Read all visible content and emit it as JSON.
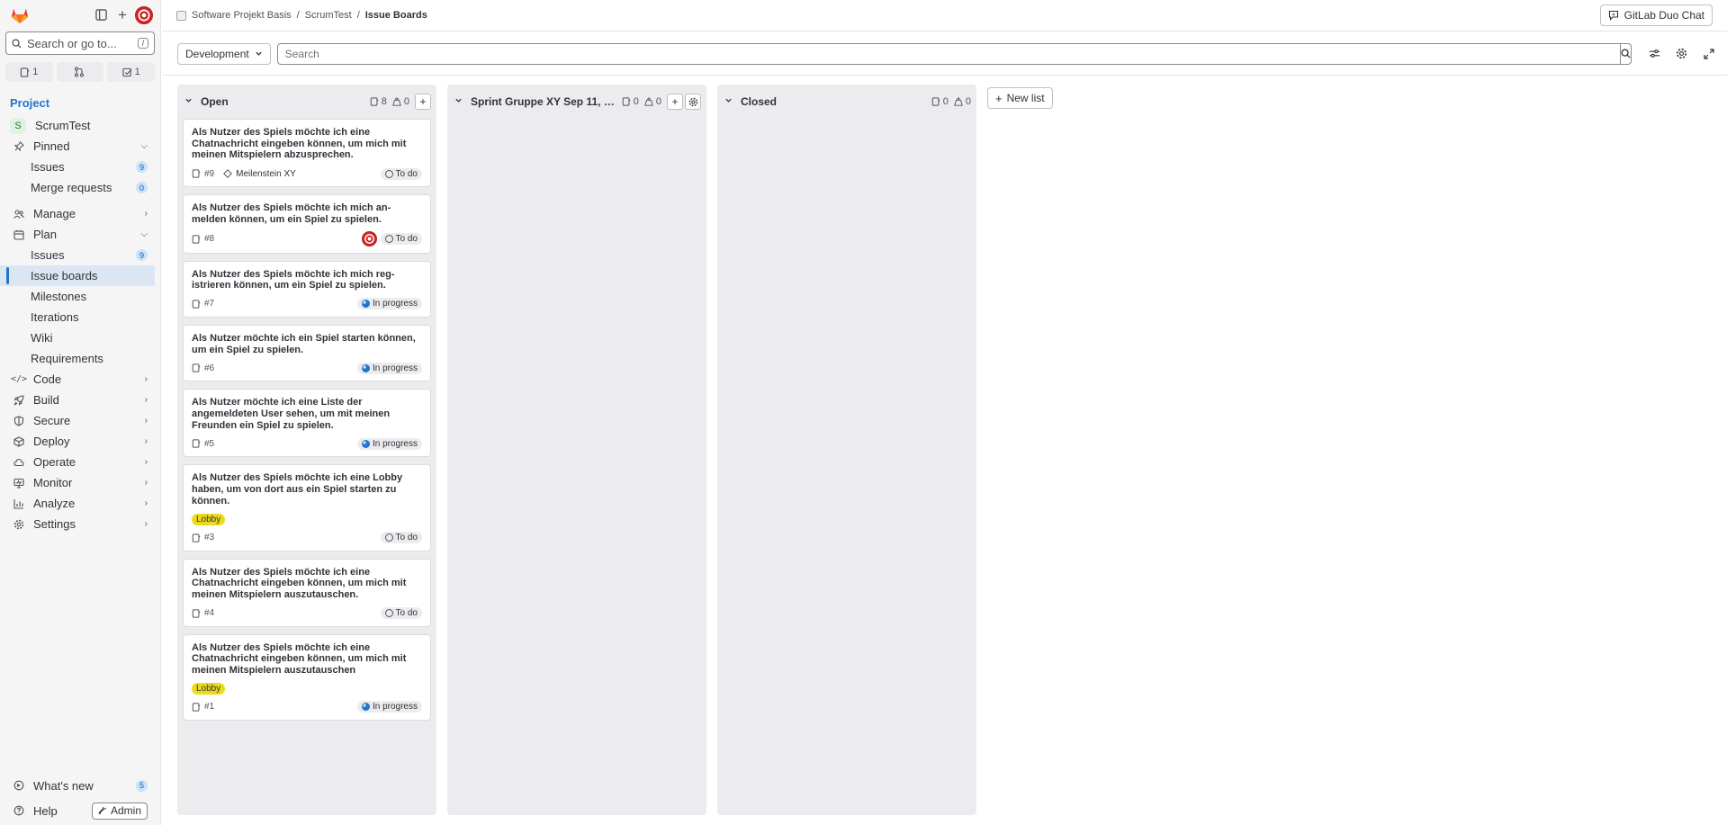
{
  "sidebar": {
    "search_placeholder": "Search or go to...",
    "search_shortcut": "/",
    "counts": {
      "issues": "1",
      "merge_requests": "",
      "todos": "1"
    },
    "section_title": "Project",
    "project_initial": "S",
    "project_name": "ScrumTest",
    "pinned": {
      "label": "Pinned",
      "items": [
        {
          "label": "Issues",
          "badge": "9"
        },
        {
          "label": "Merge requests",
          "badge": "0"
        }
      ]
    },
    "manage": "Manage",
    "plan": {
      "label": "Plan",
      "items": [
        {
          "label": "Issues",
          "badge": "9"
        },
        {
          "label": "Issue boards"
        },
        {
          "label": "Milestones"
        },
        {
          "label": "Iterations"
        },
        {
          "label": "Wiki"
        },
        {
          "label": "Requirements"
        }
      ]
    },
    "groups": [
      "Code",
      "Build",
      "Secure",
      "Deploy",
      "Operate",
      "Monitor",
      "Analyze",
      "Settings"
    ],
    "whats_new": {
      "label": "What's new",
      "badge": "5"
    },
    "help": "Help",
    "admin": "Admin"
  },
  "topbar": {
    "breadcrumbs": [
      "Software Projekt Basis",
      "ScrumTest",
      "Issue Boards"
    ],
    "duo_chat": "GitLab Duo Chat"
  },
  "filter": {
    "board_select": "Development",
    "search_placeholder": "Search"
  },
  "lists": [
    {
      "title": "Open",
      "issue_count": "8",
      "weight": "0",
      "cards": [
        {
          "title": "Als Nutzer des Spiels möchte ich eine Chatnachricht eingeben können, um mich mit meinen Mitspielern abzusprechen.",
          "ref": "#9",
          "milestone": "Meilenstein XY",
          "status": "To do"
        },
        {
          "title": "Als Nutzer des Spiels möchte ich mich an-melden können, um ein Spiel zu spielen.",
          "ref": "#8",
          "status": "To do",
          "avatar": true
        },
        {
          "title": "Als Nutzer des Spiels möchte ich mich reg-istrieren können, um ein Spiel zu spielen.",
          "ref": "#7",
          "status": "In progress"
        },
        {
          "title": "Als Nutzer möchte ich ein Spiel starten können, um ein Spiel zu spielen.",
          "ref": "#6",
          "status": "In progress"
        },
        {
          "title": "Als Nutzer möchte ich eine Liste der angemeldeten User sehen, um mit meinen Freunden ein Spiel zu spielen.",
          "ref": "#5",
          "status": "In progress"
        },
        {
          "title": "Als Nutzer des Spiels möchte ich eine Lobby haben, um von dort aus ein Spiel starten zu können.",
          "label": "Lobby",
          "ref": "#3",
          "status": "To do"
        },
        {
          "title": "Als Nutzer des Spiels möchte ich eine Chatnachricht eingeben können, um mich mit meinen Mitspielern auszutauschen.",
          "ref": "#4",
          "status": "To do"
        },
        {
          "title": "Als Nutzer des Spiels möchte ich eine Chatnachricht eingeben können, um mich mit meinen Mitspielern auszutauschen",
          "label": "Lobby",
          "ref": "#1",
          "status": "In progress"
        }
      ]
    },
    {
      "title": "Sprint Gruppe XY Sep 11, 20...",
      "issue_count": "0",
      "weight": "0",
      "cards": []
    },
    {
      "title": "Closed",
      "issue_count": "0",
      "weight": "0",
      "cards": []
    }
  ],
  "new_list": "New list",
  "colors": {
    "accent": "#1f75cb",
    "label_lobby": "#ecdb1b",
    "gitlab_orange": "#e24329"
  }
}
